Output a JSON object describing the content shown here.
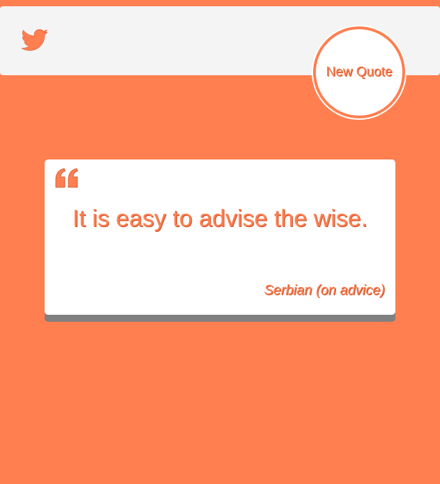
{
  "header": {
    "twitter_icon": "twitter-icon"
  },
  "new_quote_button": {
    "label": "New Quote"
  },
  "quote_card": {
    "quote_icon": "quote-left-icon",
    "text": "It is easy to advise the wise.",
    "author": "Serbian (on advice)"
  },
  "colors": {
    "background": "#ff7f50",
    "header": "#f4f4f4",
    "card": "#ffffff",
    "card_shadow": "#808080",
    "accent": "#ff7f50"
  }
}
